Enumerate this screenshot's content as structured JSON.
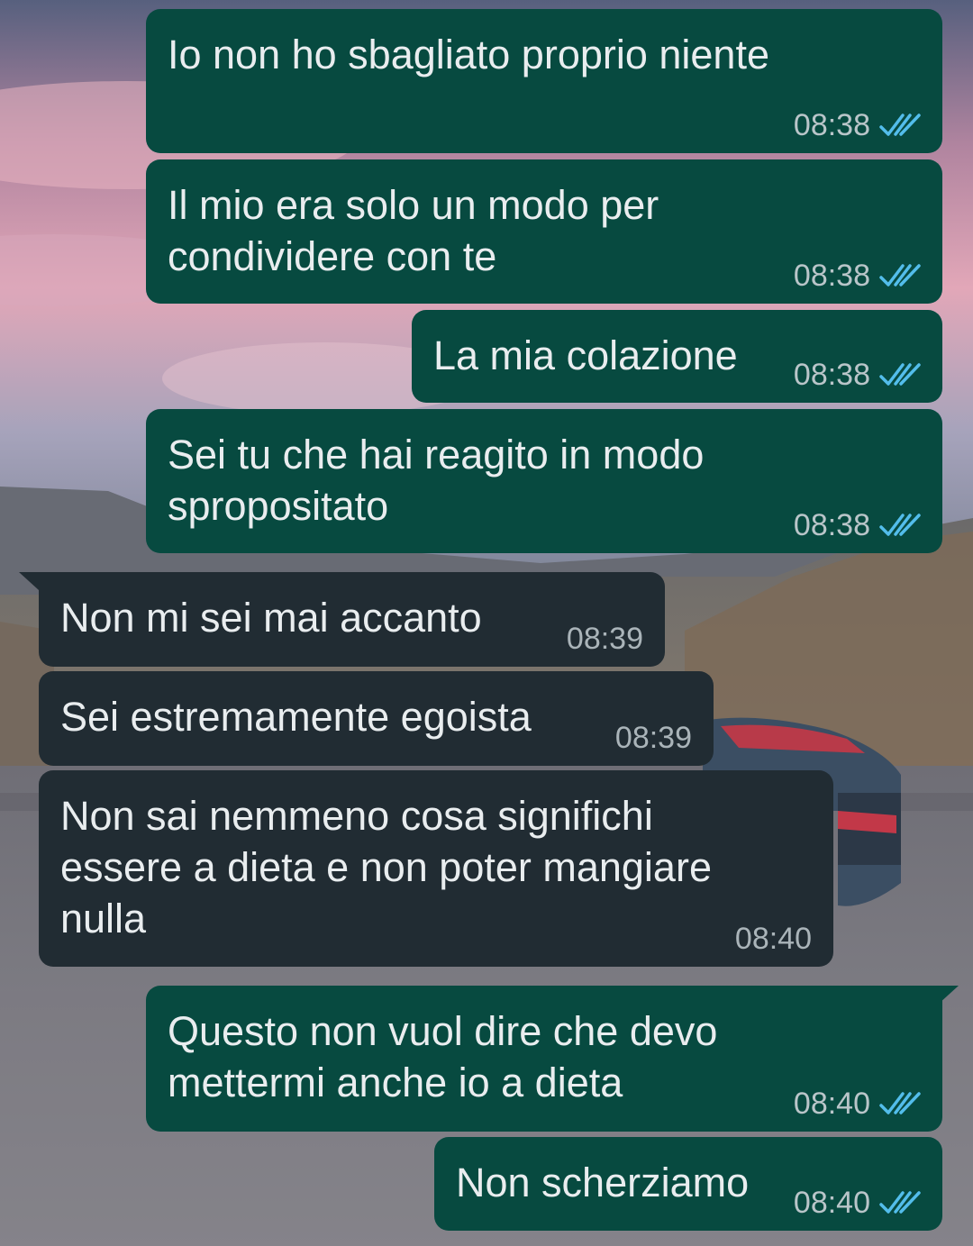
{
  "background": {
    "description_icon": "wallpaper-sunset-car"
  },
  "colors": {
    "outgoing_bubble": "#074a40",
    "incoming_bubble": "#212c33",
    "text": "#e9edef",
    "read_tick": "#53bdeb"
  },
  "messages": [
    {
      "direction": "out",
      "text": "Io non ho sbagliato proprio niente",
      "time": "08:38",
      "status": "read",
      "status_icon": "double-check-icon"
    },
    {
      "direction": "out",
      "text": "Il mio era solo un modo per\ncondividere con te",
      "time": "08:38",
      "status": "read",
      "status_icon": "double-check-icon"
    },
    {
      "direction": "out",
      "text": "La mia colazione",
      "time": "08:38",
      "status": "read",
      "status_icon": "double-check-icon"
    },
    {
      "direction": "out",
      "text": "Sei tu che hai reagito in modo\nspropositato",
      "time": "08:38",
      "status": "read",
      "status_icon": "double-check-icon"
    },
    {
      "direction": "in",
      "text": "Non mi sei mai accanto",
      "time": "08:39"
    },
    {
      "direction": "in",
      "text": "Sei estremamente egoista",
      "time": "08:39"
    },
    {
      "direction": "in",
      "text": "Non sai nemmeno cosa significhi\nessere a dieta e non poter mangiare\nnulla",
      "time": "08:40"
    },
    {
      "direction": "out",
      "text": "Questo non vuol dire che devo\nmettermi anche io a dieta",
      "time": "08:40",
      "status": "read",
      "status_icon": "double-check-icon"
    },
    {
      "direction": "out",
      "text": "Non scherziamo",
      "time": "08:40",
      "status": "read",
      "status_icon": "double-check-icon"
    }
  ]
}
